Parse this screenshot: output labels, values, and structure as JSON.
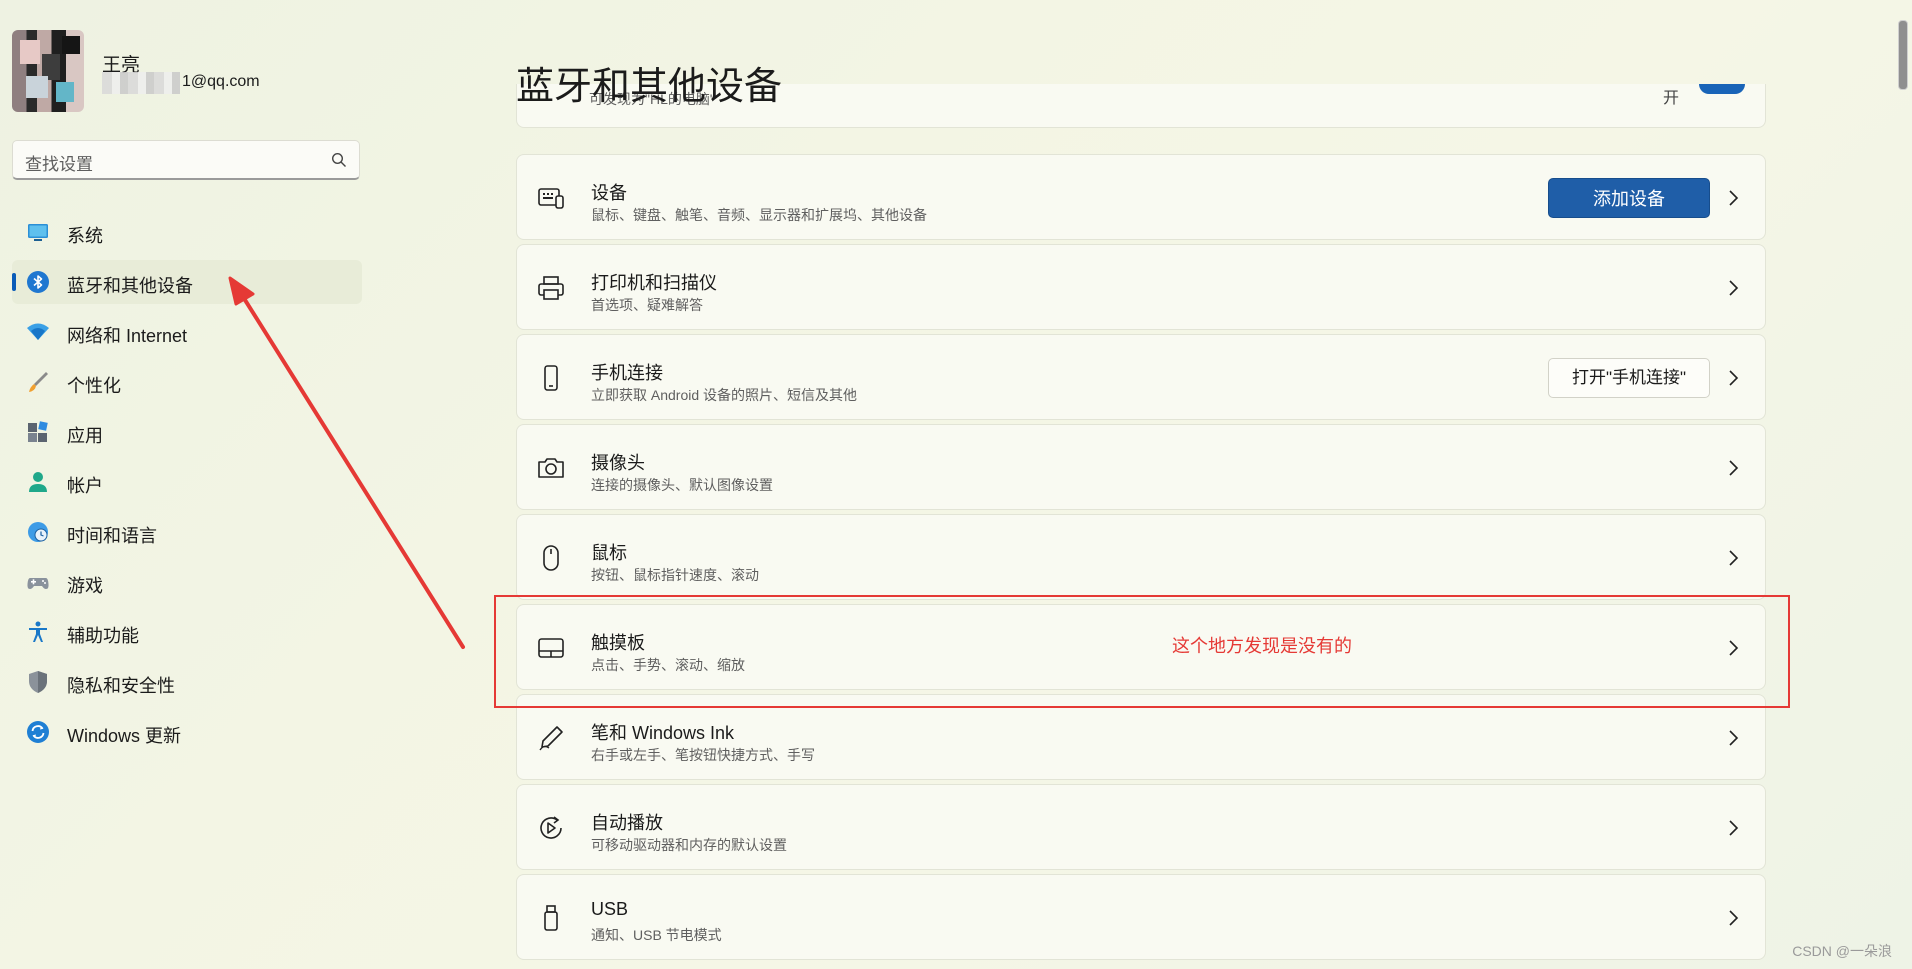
{
  "profile": {
    "name": "王亮",
    "email_suffix": "1@qq.com"
  },
  "search": {
    "placeholder": "查找设置"
  },
  "nav": {
    "items": [
      {
        "label": "系统",
        "icon": "display-icon"
      },
      {
        "label": "蓝牙和其他设备",
        "icon": "bluetooth-icon",
        "active": true
      },
      {
        "label": "网络和 Internet",
        "icon": "wifi-icon"
      },
      {
        "label": "个性化",
        "icon": "brush-icon"
      },
      {
        "label": "应用",
        "icon": "apps-icon"
      },
      {
        "label": "帐户",
        "icon": "person-icon"
      },
      {
        "label": "时间和语言",
        "icon": "globe-clock-icon"
      },
      {
        "label": "游戏",
        "icon": "gamepad-icon"
      },
      {
        "label": "辅助功能",
        "icon": "accessibility-icon"
      },
      {
        "label": "隐私和安全性",
        "icon": "shield-icon"
      },
      {
        "label": "Windows 更新",
        "icon": "update-icon"
      }
    ]
  },
  "main": {
    "title": "蓝牙和其他设备",
    "discoverable_text": "可发现为\"HL的电脑\"",
    "cards": [
      {
        "title": "设备",
        "subtitle": "鼠标、键盘、触笔、音频、显示器和扩展坞、其他设备",
        "icon": "keyboard-device-icon",
        "button": "添加设备",
        "button_style": "primary"
      },
      {
        "title": "打印机和扫描仪",
        "subtitle": "首选项、疑难解答",
        "icon": "printer-icon"
      },
      {
        "title": "手机连接",
        "subtitle": "立即获取 Android 设备的照片、短信及其他",
        "icon": "phone-icon",
        "button": "打开\"手机连接\"",
        "button_style": "secondary"
      },
      {
        "title": "摄像头",
        "subtitle": "连接的摄像头、默认图像设置",
        "icon": "camera-icon"
      },
      {
        "title": "鼠标",
        "subtitle": "按钮、鼠标指针速度、滚动",
        "icon": "mouse-icon"
      },
      {
        "title": "触摸板",
        "subtitle": "点击、手势、滚动、缩放",
        "icon": "touchpad-icon"
      },
      {
        "title": "笔和 Windows Ink",
        "subtitle": "右手或左手、笔按钮快捷方式、手写",
        "icon": "pen-icon"
      },
      {
        "title": "自动播放",
        "subtitle": "可移动驱动器和内存的默认设置",
        "icon": "autoplay-icon"
      },
      {
        "title": "USB",
        "subtitle": "通知、USB 节电模式",
        "icon": "usb-icon"
      }
    ]
  },
  "annotation": {
    "text": "这个地方发现是没有的",
    "color": "#e53935"
  },
  "watermark": "CSDN @一朵浪",
  "colors": {
    "accent": "#1f5ea8",
    "annotation": "#e53935"
  }
}
